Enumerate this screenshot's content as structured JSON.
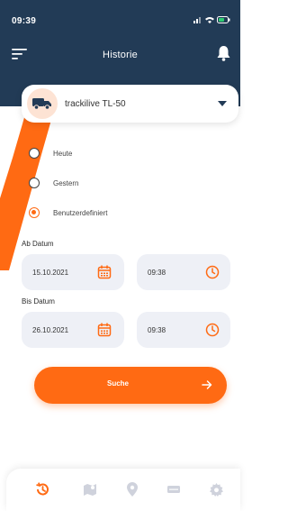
{
  "status_bar": {
    "time": "09:39"
  },
  "header": {
    "title": "Historie"
  },
  "device": {
    "name": "trackilive TL-50"
  },
  "range_options": [
    {
      "label": "Heute",
      "selected": false
    },
    {
      "label": "Gestern",
      "selected": false
    },
    {
      "label": "Benutzerdefiniert",
      "selected": true
    }
  ],
  "from": {
    "label": "Ab Datum",
    "date": "15.10.2021",
    "time": "09:38"
  },
  "to": {
    "label": "Bis Datum",
    "date": "26.10.2021",
    "time": "09:38"
  },
  "search": {
    "label": "Suche"
  },
  "bottom_nav": [
    {
      "icon": "history-icon",
      "active": true
    },
    {
      "icon": "map-icon",
      "active": false
    },
    {
      "icon": "location-pin-icon",
      "active": false
    },
    {
      "icon": "device-icon",
      "active": false
    },
    {
      "icon": "settings-icon",
      "active": false
    }
  ],
  "colors": {
    "header": "#223b56",
    "accent": "#ff6a13",
    "field_bg": "#eef0f6"
  }
}
